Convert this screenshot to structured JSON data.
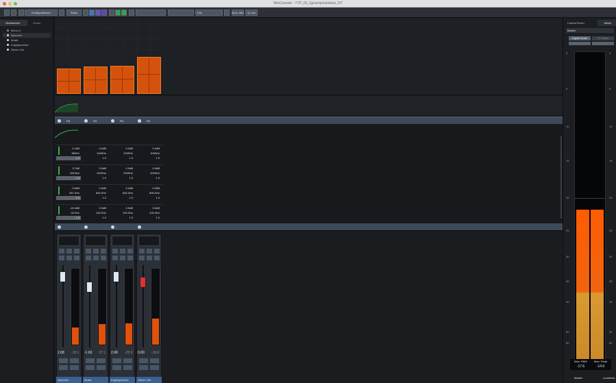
{
  "window": {
    "title": "WinConsole - TTP_03_Sprachproduktion_NT"
  },
  "colors": {
    "accent": "#d5520d",
    "panel": "#1b1c20",
    "header": "#3d4a5a",
    "name_bar": "#3a6193"
  },
  "toolbar": {
    "preset": "Konfigurationen",
    "mode": "Radio",
    "dim_label": "Dim",
    "mon_mix": "Mon. Mix",
    "q_link": "Q-Link"
  },
  "left_panel": {
    "tabs": [
      "Sichtbarkeit",
      "Zonen"
    ],
    "items": [
      "Mono In",
      "Sprecher",
      "Musik",
      "Kopplsprecher",
      "Stereo Out"
    ]
  },
  "eq": {
    "bands": [
      {
        "gain": "-0.1dB",
        "freq": "560Hz",
        "q": "1.0",
        "gain2": "0.0dB",
        "freq2": "1000Hz",
        "q2": "1.0",
        "gain3": "0.0dB",
        "freq3": "1000Hz",
        "q3": "1.0",
        "gain4": "0.0dB",
        "freq4": "1000Hz",
        "q4": "1.0"
      },
      {
        "gain": "3.7dB",
        "freq": "2819Hz",
        "q": "1.0",
        "gain2": "0.0dB",
        "freq2": "2000Hz",
        "q2": "1.0",
        "gain3": "0.0dB",
        "freq3": "2000Hz",
        "q3": "1.0",
        "gain4": "0.0dB",
        "freq4": "2000Hz",
        "q4": "1.0"
      },
      {
        "gain": "-3.6dB",
        "freq": "357.0Hz",
        "q": "1.0",
        "gain2": "0.0dB",
        "freq2": "800.0Hz",
        "q2": "1.0",
        "gain3": "0.0dB",
        "freq3": "800.0Hz",
        "q3": "1.0",
        "gain4": "0.0dB",
        "freq4": "800.0Hz",
        "q4": "1.0"
      },
      {
        "gain": "-24.0dB",
        "freq": "33.0Hz",
        "q": "1.0",
        "gain2": "0.0dB",
        "freq2": "100.0Hz",
        "q2": "1.0",
        "gain3": "0.0dB",
        "freq3": "100.0Hz",
        "q3": "1.0",
        "gain4": "0.0dB",
        "freq4": "100.0Hz",
        "q4": "1.0"
      }
    ],
    "header_labels": [
      "Rd",
      "Rd",
      "Rd",
      "Rd"
    ]
  },
  "channels": [
    {
      "name": "Sprecher",
      "gain": "2.08",
      "peak": "-19.1",
      "fader_color": "#dce9f5",
      "meter_level": 0.22
    },
    {
      "name": "Musik",
      "gain": "-1.63",
      "peak": "-27.1",
      "fader_color": "#dce9f5",
      "meter_level": 0.27
    },
    {
      "name": "Kopplsprecher",
      "gain": "2.08",
      "peak": "-25.9",
      "fader_color": "#dce9f5",
      "meter_level": 0.28
    },
    {
      "name": "Stereo Out",
      "gain": "0.00",
      "peak": "-16.6",
      "fader_color": "#e23030",
      "meter_level": 0.34
    }
  ],
  "right_panel": {
    "tabs": [
      "Control Room",
      "Meter"
    ],
    "source": "Master",
    "btn1": "Digital Scale",
    "btn2": "Cl. Ratio",
    "scale_left": [
      "0",
      "5",
      "10",
      "15",
      "20",
      "25",
      "30",
      "35",
      "40",
      "50",
      "60"
    ],
    "max_rms_label": "Max. RMS",
    "max_rms_value": "-17.6",
    "max_peak_label": "Max. Peak",
    "max_peak_value": "-14.6",
    "footer_left": "Master",
    "footer_right": "Loudness",
    "meter_level": 0.49
  },
  "top_graph": {
    "levels": [
      0.62,
      0.66,
      0.69,
      0.9
    ]
  }
}
